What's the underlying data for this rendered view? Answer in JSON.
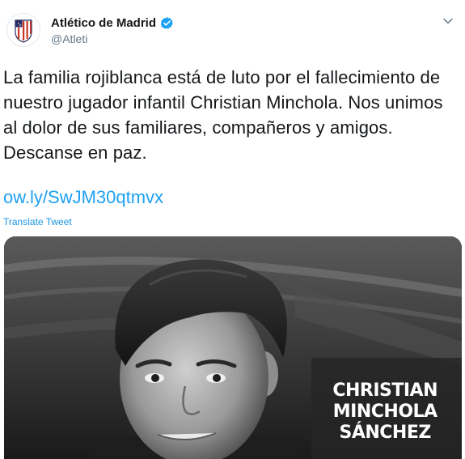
{
  "account": {
    "name": "Atlético de Madrid",
    "handle": "@Atleti"
  },
  "tweet": {
    "lines": [
      "La familia rojiblanca está de luto por el fallecimiento de",
      "nuestro jugador infantil Christian Minchola. Nos unimos",
      "al dolor de sus familiares, compañeros y amigos.",
      "Descanse en paz."
    ],
    "link": "ow.ly/SwJM30qtmvx",
    "translate": "Translate Tweet"
  },
  "media": {
    "caption_lines": [
      "CHRISTIAN",
      "MINCHOLA",
      "SÁNCHEZ"
    ]
  },
  "icons": {
    "avatar": "atletico-crest-icon",
    "verified": "verified-badge-icon",
    "menu": "chevron-down-icon"
  },
  "colors": {
    "link": "#1da1f2",
    "verified": "#1da1f2",
    "crest_red": "#cb3524",
    "crest_blue": "#272e61"
  }
}
